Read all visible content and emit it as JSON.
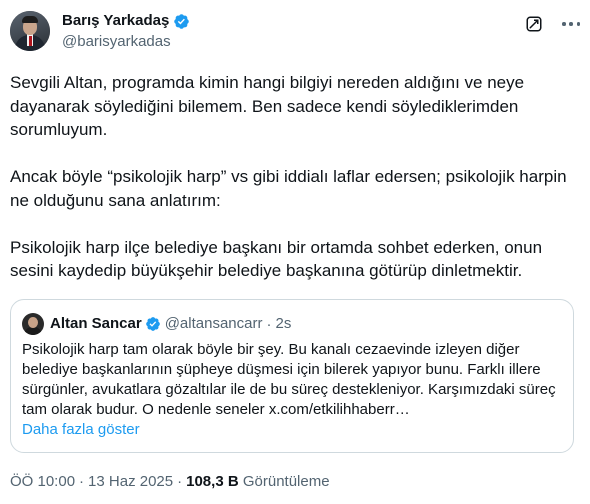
{
  "author": {
    "name": "Barış Yarkadaş",
    "handle": "@barisyarkadas"
  },
  "tweet": {
    "paragraphs": [
      "Sevgili Altan, programda kimin hangi bilgiyi nereden aldığını ve neye dayanarak söylediğini bilemem. Ben sadece kendi söylediklerimden sorumluyum.",
      "Ancak böyle “psikolojik harp” vs gibi iddialı laflar edersen; psikolojik harpin ne olduğunu sana anlatırım:",
      "Psikolojik harp ilçe belediye başkanı bir ortamda sohbet ederken, onun sesini kaydedip büyükşehir belediye başkanına götürüp dinletmektir."
    ]
  },
  "quote": {
    "name": "Altan Sancar",
    "handle": "@altansancarr",
    "separator": "·",
    "time": "2s",
    "text": "Psikolojik harp tam olarak böyle bir şey. Bu kanalı cezaevinde izleyen diğer belediye başkanlarının şüpheye düşmesi için bilerek yapıyor bunu. Farklı illere sürgünler, avukatlara gözaltılar ile de bu süreç destekleniyor. Karşımızdaki süreç tam olarak budur. O nedenle seneler x.com/etkilihhaberr…",
    "show_more": "Daha fazla göster"
  },
  "meta": {
    "time": "ÖÖ 10:00",
    "separator": "·",
    "date": "13 Haz 2025",
    "views_count": "108,3 B",
    "views_label": "Görüntüleme"
  },
  "colors": {
    "verified": "#1d9bf0",
    "link": "#1d9bf0",
    "secondary_text": "#536471",
    "border": "#cfd9de"
  },
  "icons": {
    "verified": "verified-badge-icon",
    "grok": "grok-icon",
    "more": "more-options-icon"
  }
}
